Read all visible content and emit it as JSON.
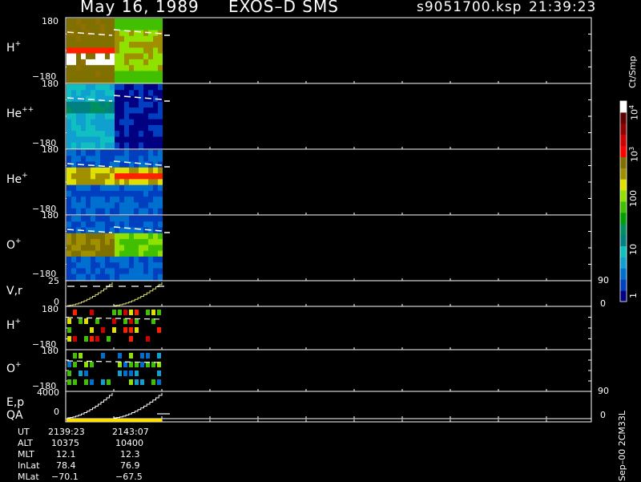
{
  "header": {
    "date": "May 16, 1989",
    "instrument": "EXOS–D SMS",
    "file": "s9051700.ksp",
    "time": "21:39:23"
  },
  "colorbar": {
    "unit": "Ct/Smp",
    "tick_labels": [
      "1",
      "10",
      "100",
      "10",
      "10"
    ],
    "exponents": [
      "3",
      "4"
    ],
    "colors": [
      "#000080",
      "#0040c0",
      "#0070d0",
      "#10a0d0",
      "#10c0c0",
      "#008080",
      "#009060",
      "#00a000",
      "#40c000",
      "#90e000",
      "#e0e000",
      "#a09000",
      "#807000",
      "#ff0000",
      "#d00000",
      "#900000",
      "#600000",
      "#ffffff"
    ]
  },
  "panels": [
    {
      "species": "H",
      "charge": "+",
      "ymax": "180",
      "ymin": "−180"
    },
    {
      "species": "He",
      "charge": "++",
      "ymax": "180",
      "ymin": "−180"
    },
    {
      "species": "He",
      "charge": "+",
      "ymax": "180",
      "ymin": "−180"
    },
    {
      "species": "O",
      "charge": "+",
      "ymax": "180",
      "ymin": "−180"
    },
    {
      "species": "V,r",
      "charge": "",
      "ymax": "25",
      "ymin": "0",
      "right_max": "90",
      "right_min": "0"
    },
    {
      "species": "H",
      "charge": "+",
      "ymax": "180",
      "ymin": "−180"
    },
    {
      "species": "O",
      "charge": "+",
      "ymax": "180",
      "ymin": "−180"
    },
    {
      "species": "E,p",
      "charge": "",
      "ymax": "4000",
      "ymin": "0",
      "right_max": "90",
      "right_min": "0"
    },
    {
      "species": "QA",
      "charge": ""
    }
  ],
  "ephemeris": {
    "labels": [
      "UT",
      "ALT",
      "MLT",
      "InLat",
      "MLat"
    ],
    "col1": [
      "2139:23",
      "10375",
      "12.1",
      "78.4",
      "−70.1"
    ],
    "col2": [
      "2143:07",
      "10400",
      "12.3",
      "76.9",
      "−67.5"
    ]
  },
  "footer_vertical": "Sep–00 2CM33L",
  "chart_data": {
    "type": "heatmap",
    "title": "May 16, 1989   EXOS–D SMS   s9051700.ksp  21:39:23",
    "x": [
      "2139:23",
      "2143:07"
    ],
    "panels": [
      "H+",
      "He++",
      "He+",
      "O+",
      "V,r",
      "H+",
      "O+",
      "E,p",
      "QA"
    ],
    "ylim_angle": [
      -180,
      180
    ],
    "colorbar_range": [
      1,
      10000
    ],
    "colorbar_scale": "log",
    "colorbar_unit": "Ct/Smp"
  }
}
